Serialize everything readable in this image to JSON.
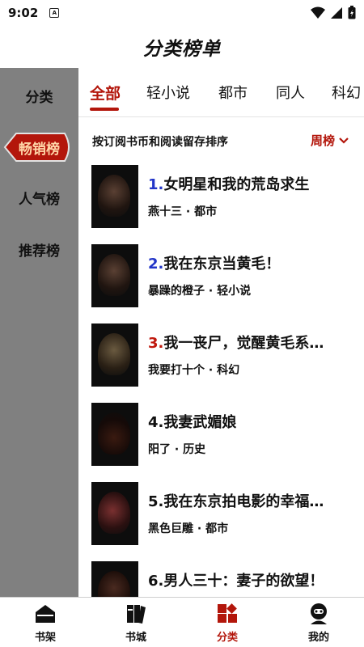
{
  "status": {
    "time": "9:02",
    "app_glyph": "A"
  },
  "header": {
    "title": "分类榜单"
  },
  "sidebar": {
    "items": [
      {
        "label": "分类"
      },
      {
        "label": "畅销榜"
      },
      {
        "label": "人气榜"
      },
      {
        "label": "推荐榜"
      }
    ]
  },
  "tabs": [
    {
      "label": "全部"
    },
    {
      "label": "轻小说"
    },
    {
      "label": "都市"
    },
    {
      "label": "同人"
    },
    {
      "label": "科幻"
    }
  ],
  "sort": {
    "description": "按订阅书币和阅读留存排序",
    "selected": "周榜"
  },
  "books": [
    {
      "rank": "1.",
      "title": "女明星和我的荒岛求生",
      "meta": "燕十三 · 都市",
      "rank_color": "blue"
    },
    {
      "rank": "2.",
      "title": "我在东京当黄毛！",
      "meta": "暴躁的橙子 · 轻小说",
      "rank_color": "blue"
    },
    {
      "rank": "3.",
      "title": "我一丧尸，觉醒黄毛系…",
      "meta": "我要打十个 · 科幻",
      "rank_color": "red"
    },
    {
      "rank": "4.",
      "title": "我妻武媚娘",
      "meta": "阳了 · 历史",
      "rank_color": "black"
    },
    {
      "rank": "5.",
      "title": "我在东京拍电影的幸福…",
      "meta": "黑色巨雕 · 都市",
      "rank_color": "black"
    },
    {
      "rank": "6.",
      "title": "男人三十：妻子的欲望！",
      "meta": "",
      "rank_color": "black"
    }
  ],
  "bottom_nav": [
    {
      "label": "书架",
      "icon": "bookshelf-icon"
    },
    {
      "label": "书城",
      "icon": "bookstore-icon"
    },
    {
      "label": "分类",
      "icon": "category-icon"
    },
    {
      "label": "我的",
      "icon": "profile-icon"
    }
  ],
  "colors": {
    "accent": "#b3160b",
    "sidebar_bg": "#808080",
    "rank_blue": "#2235c8"
  }
}
